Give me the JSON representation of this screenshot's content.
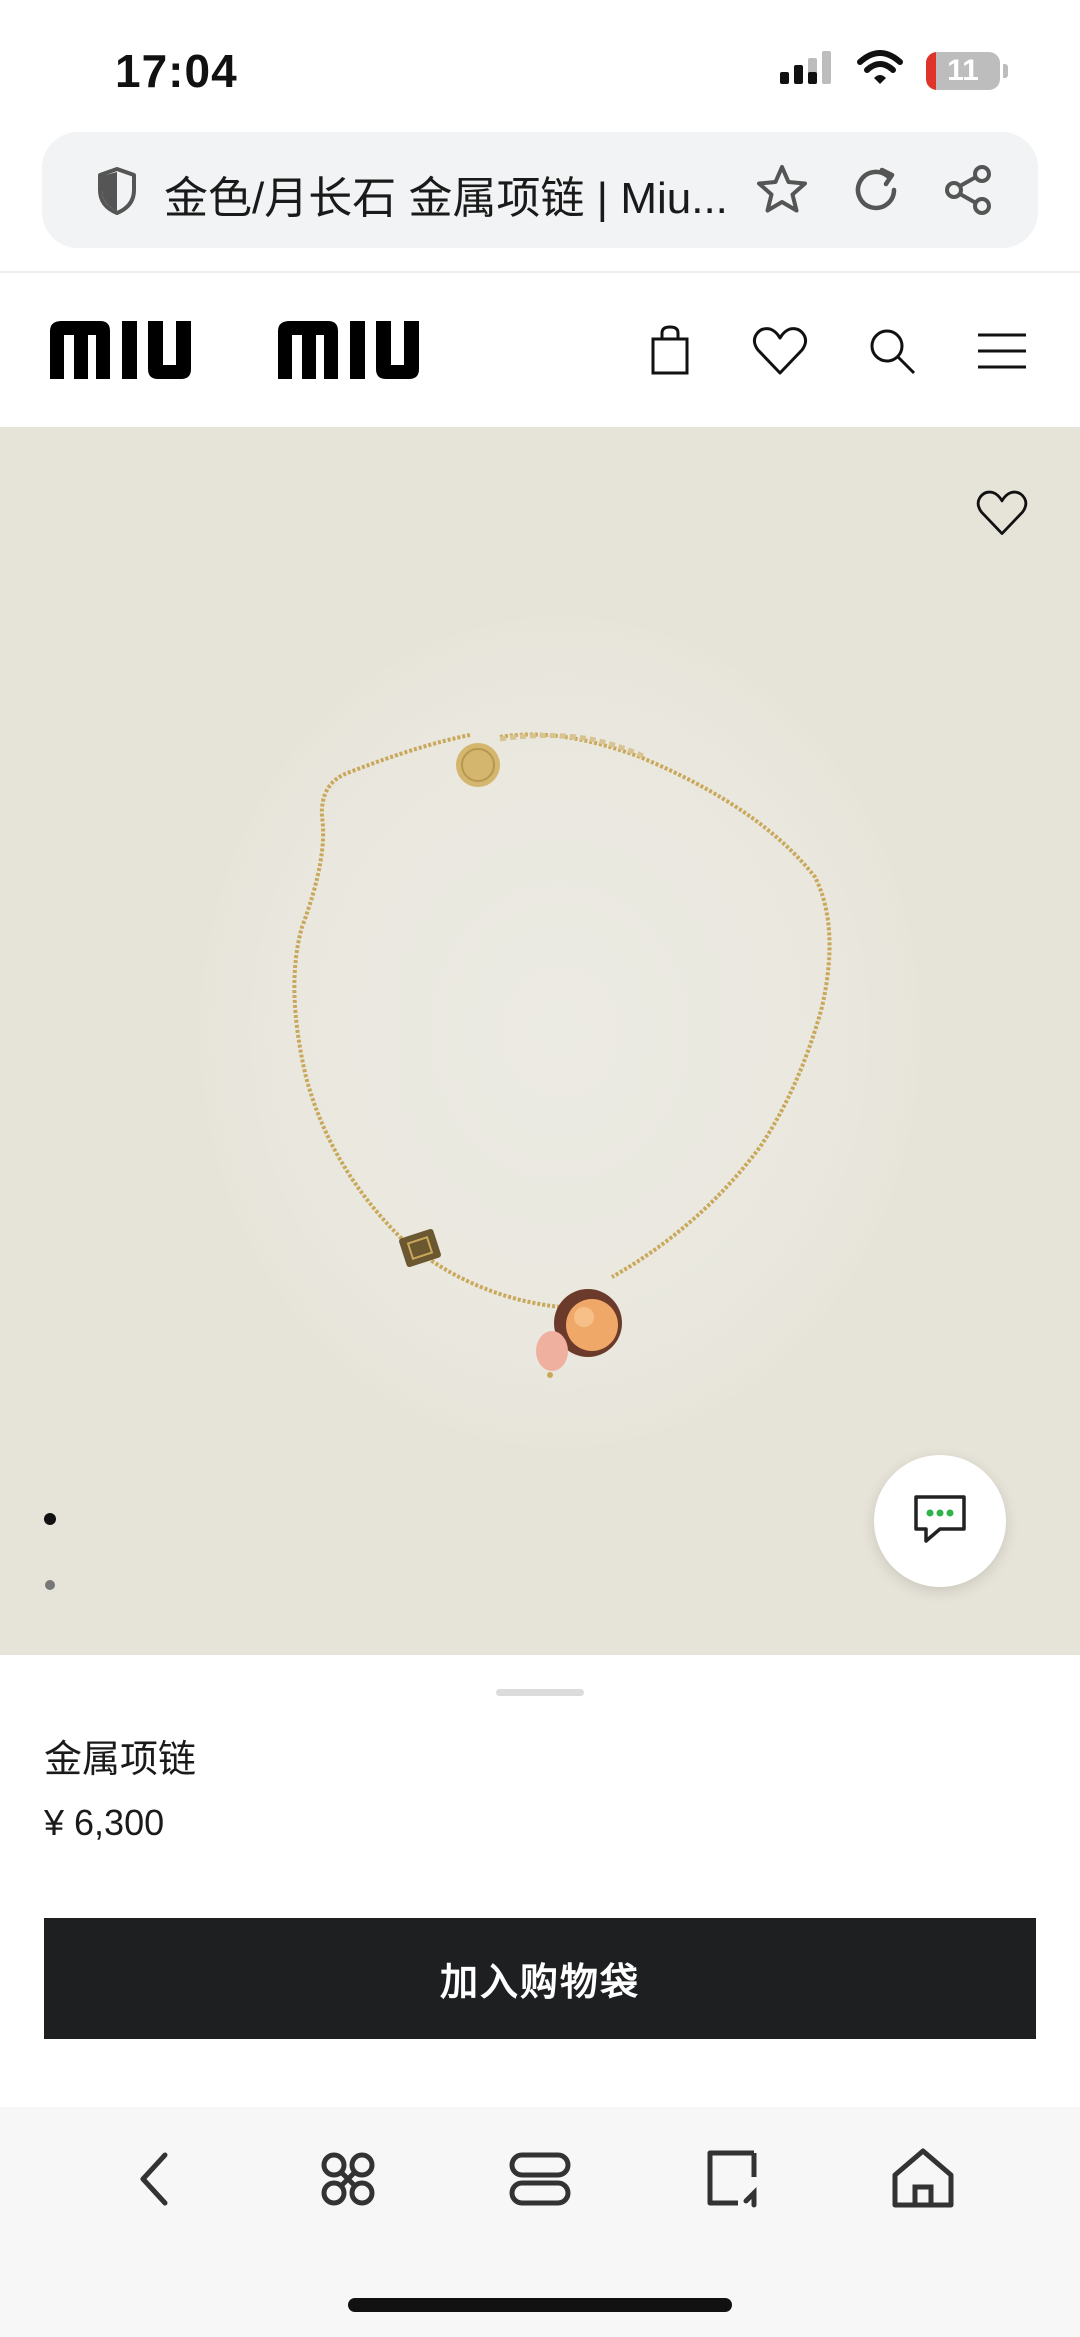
{
  "status_bar": {
    "time": "17:04",
    "battery_level": "11",
    "icons": [
      "cellular-signal-icon",
      "wifi-icon",
      "battery-icon"
    ]
  },
  "address_bar": {
    "url_title": "金色/月长石 金属项链 | Miu...",
    "icons": [
      "shield-icon",
      "star-icon",
      "reload-icon",
      "share-icon"
    ]
  },
  "site_header": {
    "logo_text": "miu miu",
    "icons": [
      "shopping-bag-icon",
      "heart-icon",
      "search-icon",
      "menu-icon"
    ]
  },
  "gallery": {
    "current_image": 1,
    "image_count": 2,
    "icons": [
      "heart-icon",
      "chat-icon"
    ]
  },
  "product": {
    "name": "金属项链",
    "price": "¥ 6,300",
    "add_to_bag_label": "加入购物袋"
  },
  "browser_nav": {
    "icons": [
      "back-icon",
      "extensions-icon",
      "tabs-icon",
      "new-tab-icon",
      "home-icon"
    ]
  },
  "colors": {
    "image_background": "#e6e3d8",
    "button_background": "#1e1f21",
    "battery_low": "#e0342b",
    "chat_dots": "#2fb34a"
  }
}
